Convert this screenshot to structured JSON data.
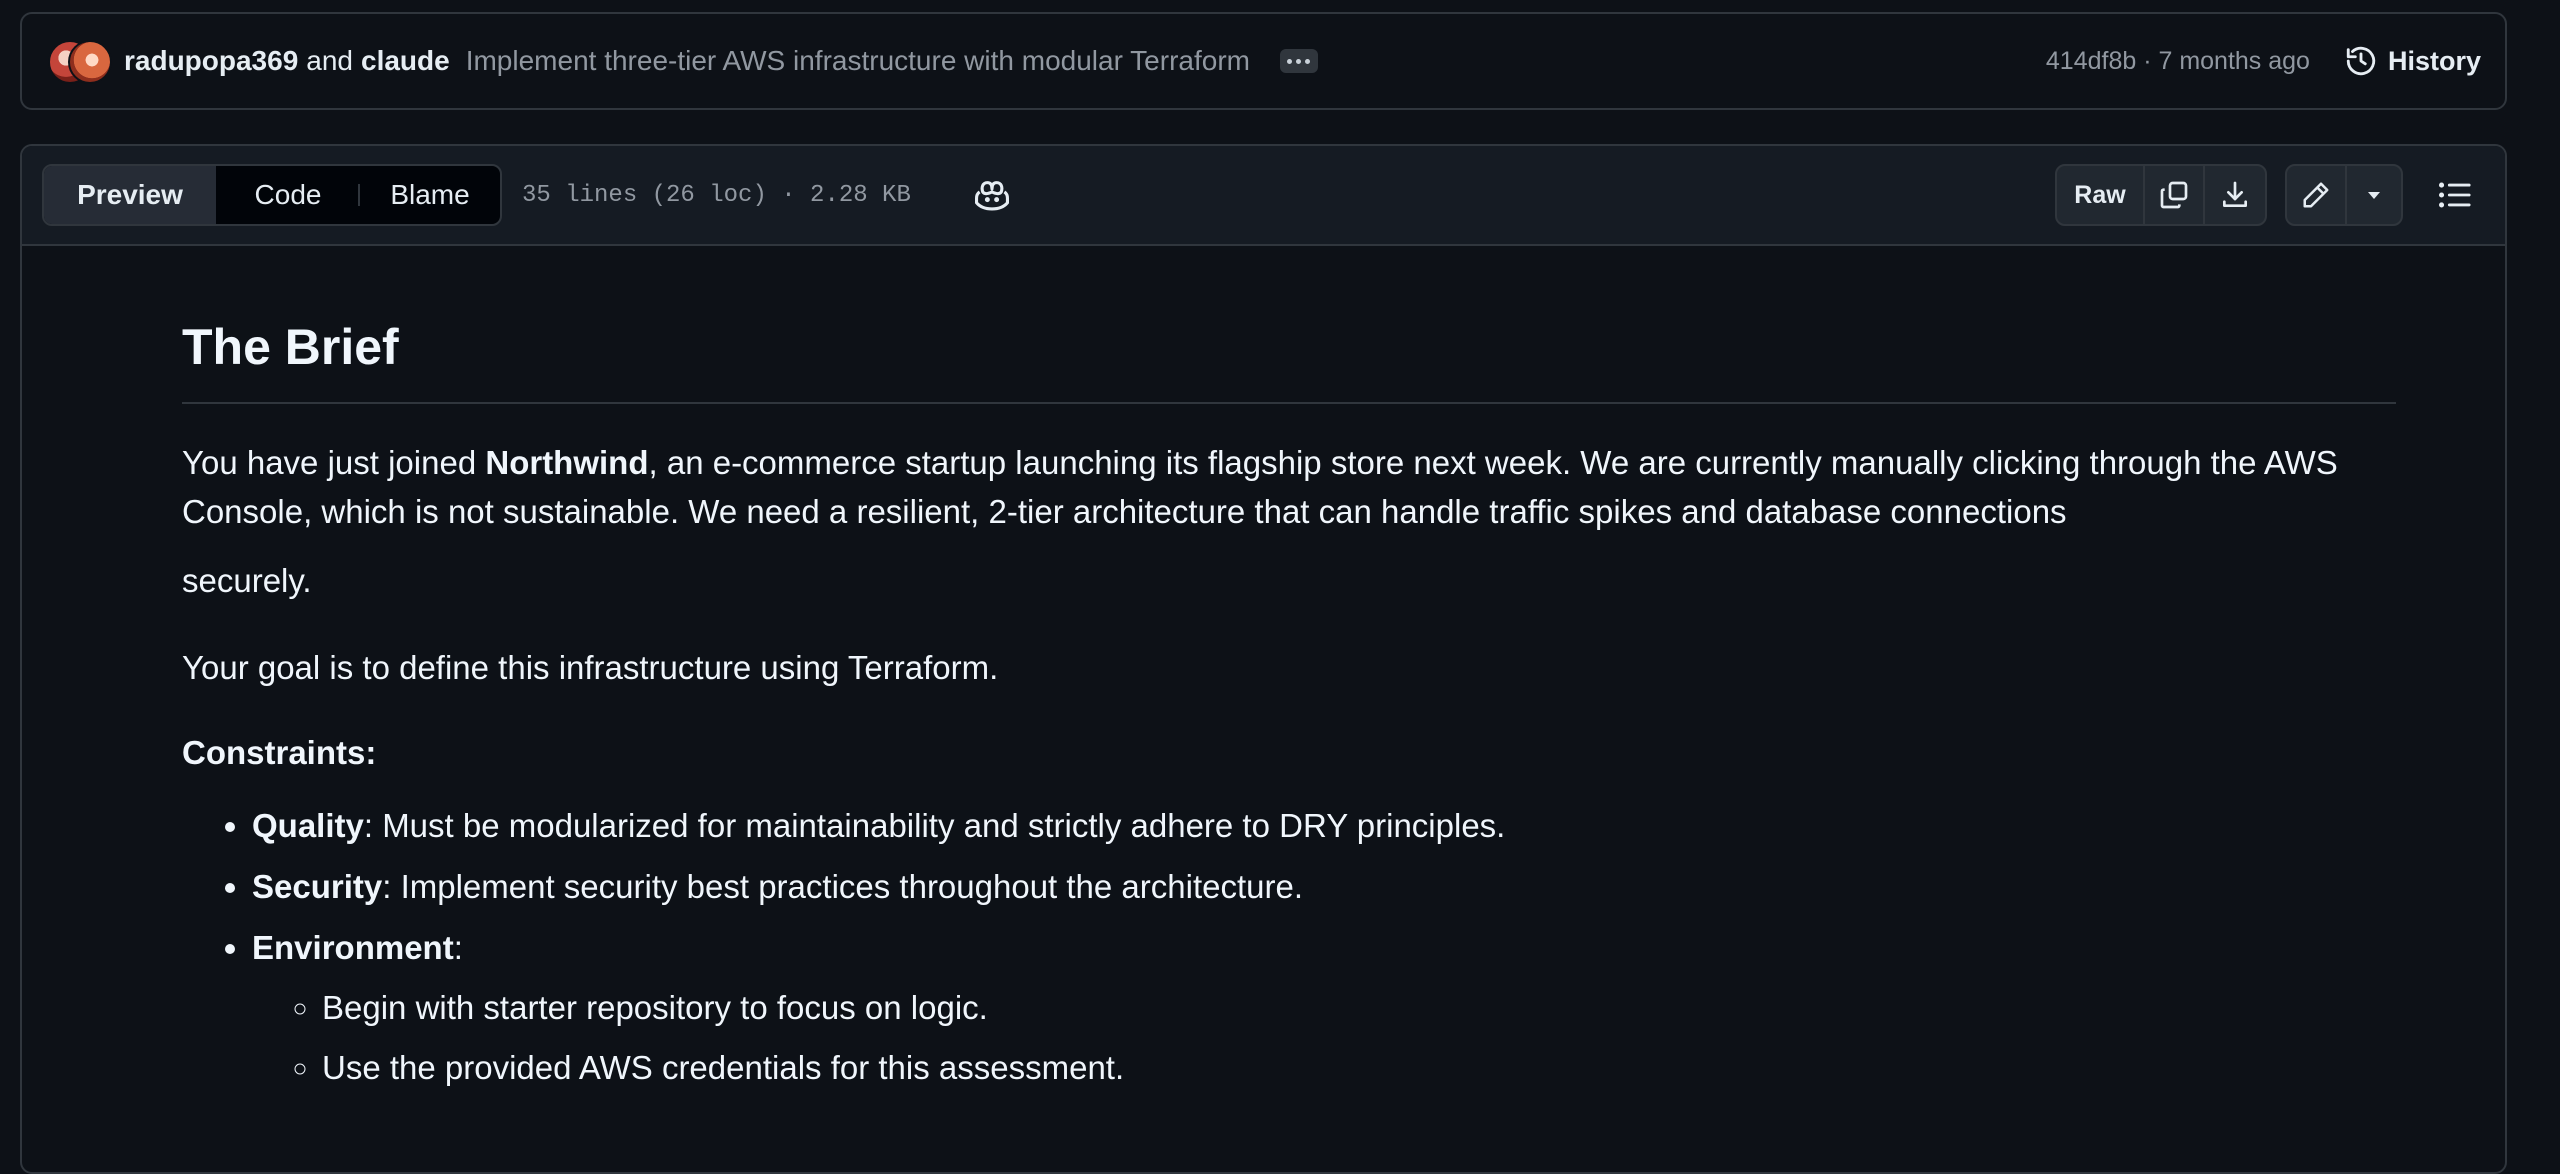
{
  "commit": {
    "authors": [
      "radupopa369",
      "claude"
    ],
    "and_text": "and",
    "message": "Implement three-tier AWS infrastructure with modular Terraform",
    "sha_age": "414df8b · 7 months ago",
    "history_label": "History"
  },
  "file_header": {
    "tabs": [
      "Preview",
      "Code",
      "Blame"
    ],
    "active_tab": "Preview",
    "meta": "35 lines (26 loc) · 2.28 KB",
    "raw_label": "Raw",
    "icons": [
      "copilot-icon",
      "copy-icon",
      "download-icon",
      "pencil-icon",
      "triangle-down-icon",
      "list-unordered-icon",
      "history-icon",
      "kebab-horizontal-icon"
    ]
  },
  "content": {
    "heading": "The Brief",
    "p1_pre": "You have just joined ",
    "p1_bold": "Northwind",
    "p1_post": ", an e-commerce startup launching its flagship store next week. We are currently manually clicking through the AWS Console, which is not sustainable. We need a resilient, 2-tier architecture that can handle traffic spikes and database connections",
    "p1_tail": "securely.",
    "p2": "Your goal is to define this infrastructure using Terraform.",
    "constraints_label": "Constraints:",
    "constraints": [
      {
        "label": "Quality",
        "text": ": Must be modularized for maintainability and strictly adhere to DRY principles."
      },
      {
        "label": "Security",
        "text": ": Implement security best practices throughout the architecture."
      },
      {
        "label": "Environment",
        "text": ":"
      }
    ],
    "environment_items": [
      "Begin with starter repository to focus on logic.",
      "Use the provided AWS credentials for this assessment."
    ]
  },
  "colors": {
    "background": "#0d1117",
    "header_bg": "#151b23",
    "border": "#30363d",
    "text": "#e6edf3",
    "muted": "#9198a1"
  }
}
